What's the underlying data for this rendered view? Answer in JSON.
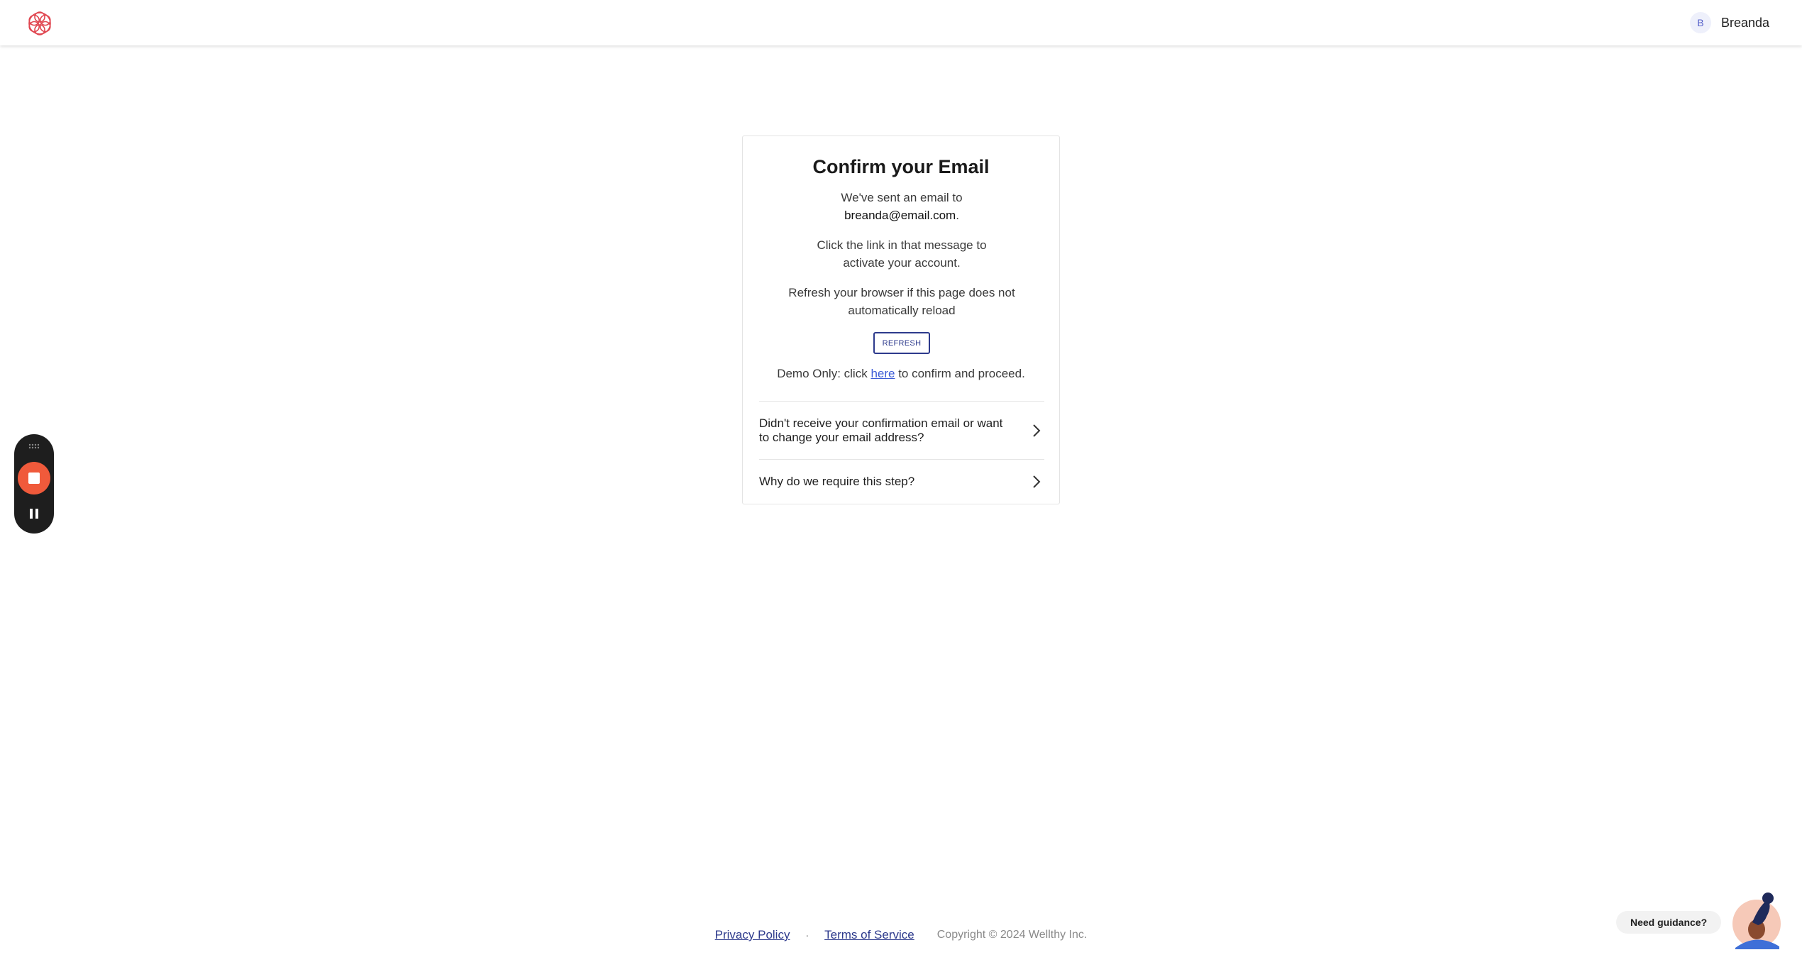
{
  "header": {
    "logo_icon": "wellthy-logo-icon",
    "user_initial": "B",
    "user_name": "Breanda"
  },
  "card": {
    "title": "Confirm your Email",
    "sent_line": "We've sent an email to",
    "email": "breanda@email.com",
    "email_suffix": ".",
    "click_line_1": "Click the link in that message to",
    "click_line_2": "activate your account.",
    "refresh_line_1": "Refresh your browser if this page does not",
    "refresh_line_2": "automatically reload",
    "refresh_button": "REFRESH",
    "demo_prefix": "Demo Only: click ",
    "demo_link": "here",
    "demo_suffix": " to confirm and proceed.",
    "accordion": [
      {
        "label": "Didn't receive your confirmation email or want to change your email address?"
      },
      {
        "label": "Why do we require this step?"
      }
    ]
  },
  "recorder": {
    "grip_icon": "drag-grip-icon",
    "stop_icon": "stop-icon",
    "pause_icon": "pause-icon"
  },
  "footer": {
    "privacy": "Privacy Policy",
    "separator": "·",
    "terms": "Terms of Service",
    "copyright": "Copyright © 2024 Wellthy Inc."
  },
  "guidance": {
    "label": "Need guidance?"
  },
  "colors": {
    "primary": "#2d3a8c",
    "link": "#3c5bd6",
    "logo": "#e0454f",
    "record": "#f05a3b"
  }
}
